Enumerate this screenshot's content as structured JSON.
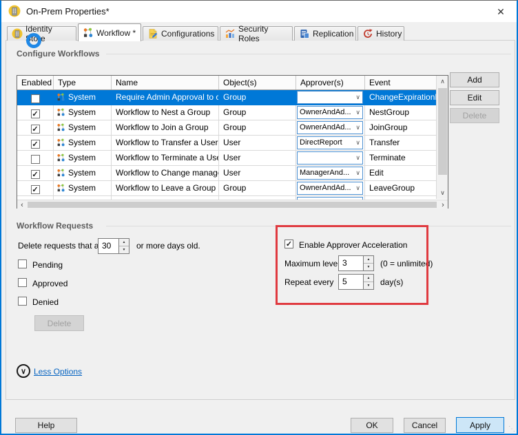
{
  "window": {
    "title": "On-Prem Properties*"
  },
  "icons": {
    "close": "✕",
    "check": "✓",
    "combo_chevron": "∨",
    "scroll_up": "∧",
    "scroll_down": "∨",
    "scroll_left": "‹",
    "scroll_right": "›",
    "spin_up": "▲",
    "spin_down": "▼",
    "expander_chevron": "∨",
    "resize_grip": "⋱"
  },
  "tabs": [
    {
      "label": "Identity Store",
      "active": false
    },
    {
      "label": "Workflow *",
      "active": true
    },
    {
      "label": "Configurations",
      "active": false
    },
    {
      "label": "Security Roles",
      "active": false
    },
    {
      "label": "Replication",
      "active": false
    },
    {
      "label": "History",
      "active": false
    }
  ],
  "configure_workflows": {
    "title": "Configure Workflows",
    "table": {
      "headers": [
        "Enabled",
        "Type",
        "Name",
        "Object(s)",
        "Approver(s)",
        "Event"
      ],
      "rows": [
        {
          "enabled": false,
          "selected": true,
          "type": "System",
          "name": "Require Admin Approval to c...",
          "object": "Group",
          "approver": "",
          "event": "ChangeExpirationP..."
        },
        {
          "enabled": true,
          "selected": false,
          "type": "System",
          "name": "Workflow to Nest a Group",
          "object": "Group",
          "approver": "OwnerAndAd...",
          "event": "NestGroup"
        },
        {
          "enabled": true,
          "selected": false,
          "type": "System",
          "name": "Workflow to Join a Group",
          "object": "Group",
          "approver": "OwnerAndAd...",
          "event": "JoinGroup"
        },
        {
          "enabled": true,
          "selected": false,
          "type": "System",
          "name": "Workflow to Transfer a User",
          "object": "User",
          "approver": "DirectReport",
          "event": "Transfer"
        },
        {
          "enabled": false,
          "selected": false,
          "type": "System",
          "name": "Workflow to Terminate a User",
          "object": "User",
          "approver": "",
          "event": "Terminate"
        },
        {
          "enabled": true,
          "selected": false,
          "type": "System",
          "name": "Workflow to Change manager",
          "object": "User",
          "approver": "ManagerAnd...",
          "event": "Edit"
        },
        {
          "enabled": true,
          "selected": false,
          "type": "System",
          "name": "Workflow to Leave a Group",
          "object": "Group",
          "approver": "OwnerAndAd...",
          "event": "LeaveGroup"
        }
      ]
    },
    "buttons": {
      "add": "Add",
      "edit": "Edit",
      "delete": "Delete"
    }
  },
  "workflow_requests": {
    "title": "Workflow Requests",
    "delete_line": {
      "prefix": "Delete requests that are",
      "days": "30",
      "suffix": "or more days old."
    },
    "filters": [
      {
        "label": "Pending",
        "checked": false
      },
      {
        "label": "Approved",
        "checked": false
      },
      {
        "label": "Denied",
        "checked": false
      }
    ],
    "delete_button": "Delete",
    "acceleration": {
      "enabled": true,
      "enable_label": "Enable Approver Acceleration",
      "max_levels_label": "Maximum levels",
      "max_levels": "3",
      "max_levels_hint": "(0 = unlimited)",
      "repeat_label": "Repeat every",
      "repeat_days": "5",
      "repeat_hint": "day(s)"
    }
  },
  "less_options_label": "Less Options",
  "footer": {
    "help": "Help",
    "ok": "OK",
    "cancel": "Cancel",
    "apply": "Apply"
  },
  "colors": {
    "accent": "#0078d7",
    "selection": "#0078d7",
    "annotation_red": "#e03a40",
    "link_blue": "#0563c1",
    "combo_border": "#4a8fd2"
  }
}
